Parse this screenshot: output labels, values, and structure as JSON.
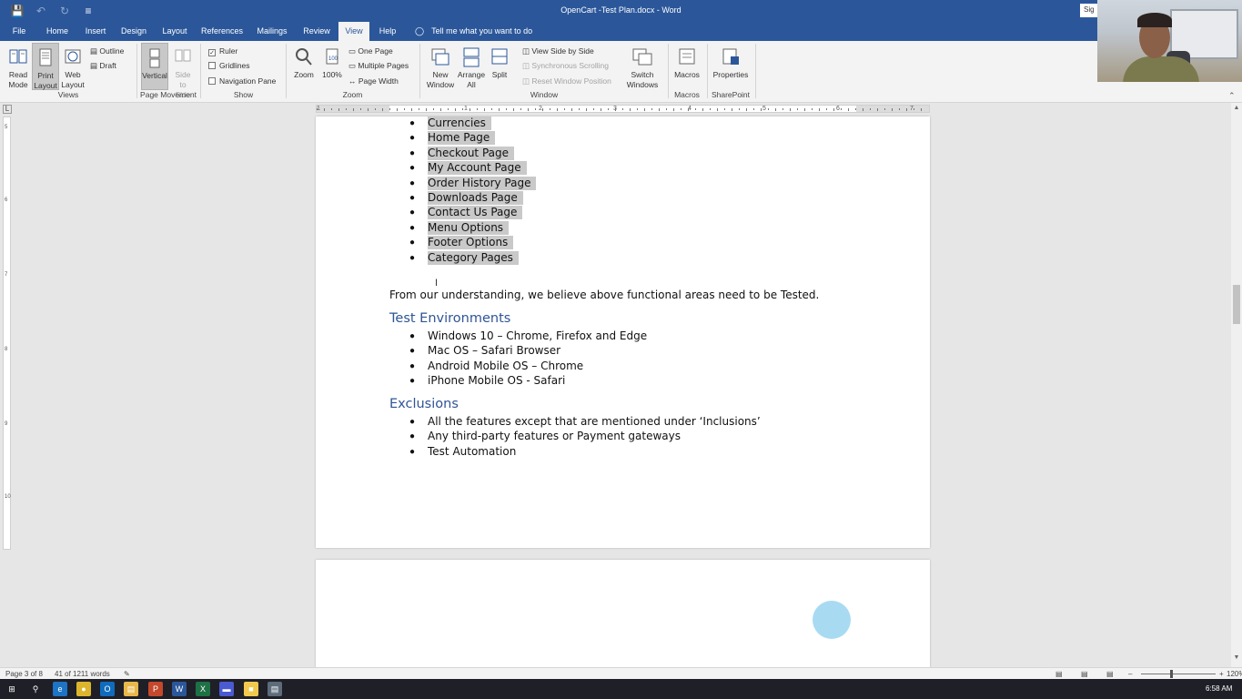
{
  "window": {
    "title": "OpenCart -Test Plan.docx  -  Word",
    "sign_in": "Sig"
  },
  "tabs": [
    "File",
    "Home",
    "Insert",
    "Design",
    "Layout",
    "References",
    "Mailings",
    "Review",
    "View",
    "Help"
  ],
  "active_tab": "View",
  "tell_me": "Tell me what you want to do",
  "ribbon": {
    "views": {
      "read_mode": "Read Mode",
      "print_layout": "Print Layout",
      "web_layout": "Web Layout",
      "outline": "Outline",
      "draft": "Draft",
      "group": "Views"
    },
    "page_movement": {
      "vertical": "Vertical",
      "side_to_side": "Side to Side",
      "group": "Page Movement"
    },
    "show": {
      "ruler": "Ruler",
      "gridlines": "Gridlines",
      "navigation_pane": "Navigation Pane",
      "group": "Show",
      "ruler_checked": true,
      "gridlines_checked": false,
      "navigation_pane_checked": false
    },
    "zoom": {
      "zoom": "Zoom",
      "hundred": "100%",
      "one_page": "One Page",
      "multiple_pages": "Multiple Pages",
      "page_width": "Page Width",
      "group": "Zoom"
    },
    "window": {
      "new_window": "New Window",
      "arrange_all": "Arrange All",
      "split": "Split",
      "view_side_by_side": "View Side by Side",
      "synchronous_scrolling": "Synchronous Scrolling",
      "reset_window_position": "Reset Window Position",
      "switch_windows": "Switch Windows",
      "group": "Window"
    },
    "macros": {
      "macros": "Macros",
      "group": "Macros"
    },
    "sharepoint": {
      "properties": "Properties",
      "group": "SharePoint"
    }
  },
  "ruler_numbers": [
    "1",
    "1",
    "2",
    "3",
    "4",
    "5",
    "6",
    "7"
  ],
  "vruler_numbers": [
    "5",
    "6",
    "7",
    "8",
    "9",
    "10"
  ],
  "document": {
    "selected_items": [
      "Currencies",
      "Home Page",
      "Checkout Page",
      "My Account Page",
      "Order History Page",
      "Downloads Page",
      "Contact Us Page",
      "Menu Options",
      "Footer Options",
      "Category Pages"
    ],
    "paragraph": "From our understanding, we believe above functional areas need to be Tested.",
    "test_env_heading": "Test Environments",
    "test_env_items": [
      "Windows 10 – Chrome, Firefox and Edge",
      "Mac OS – Safari Browser",
      "Android Mobile OS – Chrome",
      "iPhone Mobile OS - Safari"
    ],
    "exclusions_heading": "Exclusions",
    "exclusions_items": [
      "All the features except that are mentioned under ‘Inclusions’",
      "Any third-party features or Payment gateways",
      "Test Automation"
    ]
  },
  "status": {
    "page": "Page 3 of 8",
    "words": "41 of 1211 words",
    "zoom": "120%"
  },
  "taskbar": {
    "time": "6:58 AM"
  },
  "colors": {
    "word_blue": "#2b579a",
    "heading_blue": "#2f5496",
    "selection_gray": "#c9c9c9"
  }
}
